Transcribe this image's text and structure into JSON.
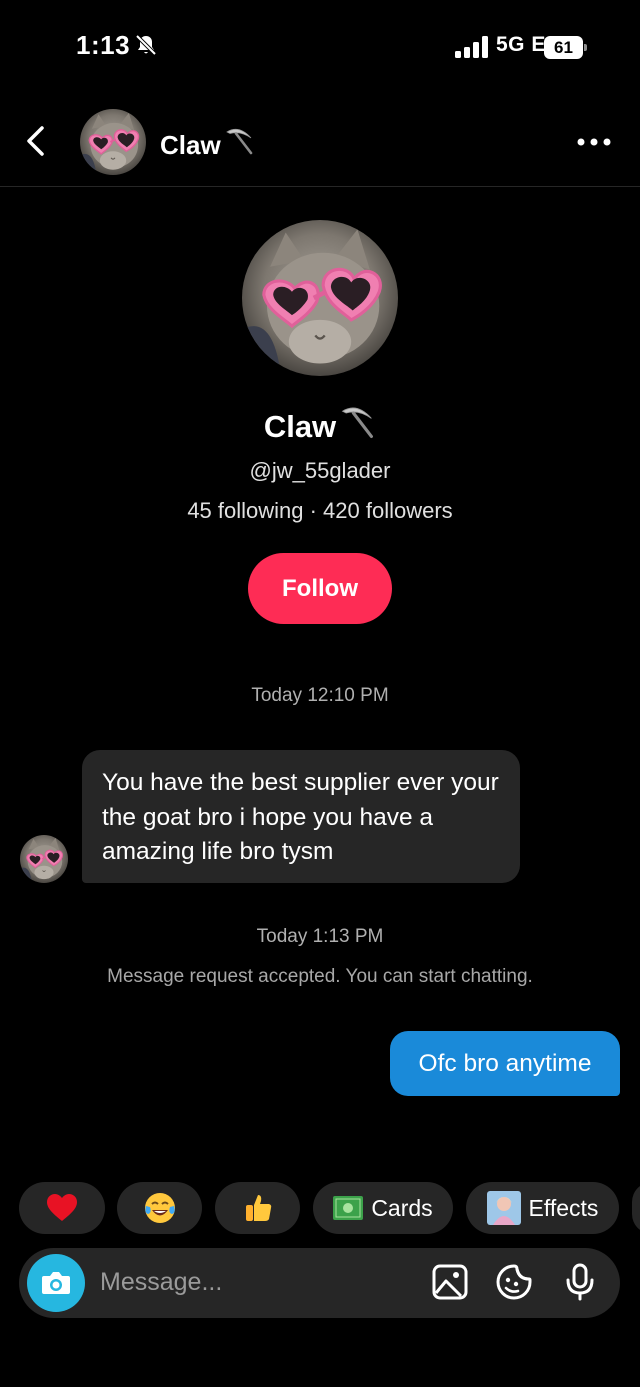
{
  "status_bar": {
    "time": "1:13",
    "network": "5G E",
    "battery": "61"
  },
  "header": {
    "name": "Claw"
  },
  "profile": {
    "name": "Claw",
    "handle": "@jw_55glader",
    "stats": "45 following · 420 followers",
    "follow_label": "Follow"
  },
  "chat": {
    "timestamp_1": "Today 12:10 PM",
    "incoming_message": "You have the best supplier ever your the goat bro i hope you have a amazing life bro tysm",
    "timestamp_2": "Today 1:13 PM",
    "system_message": "Message request accepted. You can start chatting.",
    "outgoing_message": "Ofc bro anytime"
  },
  "quick_actions": {
    "reactions": [
      "heart-emoji",
      "tears-of-joy-emoji",
      "thumbs-up-emoji"
    ],
    "cards_label": "Cards",
    "effects_label": "Effects"
  },
  "composer": {
    "placeholder": "Message..."
  },
  "colors": {
    "follow": "#fe2c55",
    "outgoing_bubble": "#1a8ad9",
    "incoming_bubble": "#262626",
    "camera": "#26b7e0"
  }
}
